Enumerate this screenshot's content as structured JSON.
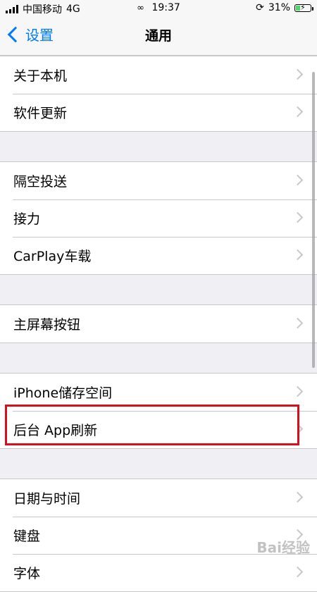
{
  "status": {
    "carrier": "中国移动",
    "network": "4G",
    "time": "19:37",
    "battery_text": "31%",
    "battery_level": 0.31
  },
  "nav": {
    "back_label": "设置",
    "title": "通用"
  },
  "groups": [
    {
      "items": [
        "关于本机",
        "软件更新"
      ]
    },
    {
      "items": [
        "隔空投送",
        "接力",
        "CarPlay车载"
      ]
    },
    {
      "items": [
        "主屏幕按钮"
      ]
    },
    {
      "items": [
        "iPhone储存空间",
        "后台 App刷新"
      ]
    },
    {
      "items": [
        "日期与时间",
        "键盘",
        "字体"
      ]
    }
  ],
  "watermark": "Bai经验",
  "colors": {
    "accent": "#007aff",
    "highlight": "#d60f1a"
  }
}
